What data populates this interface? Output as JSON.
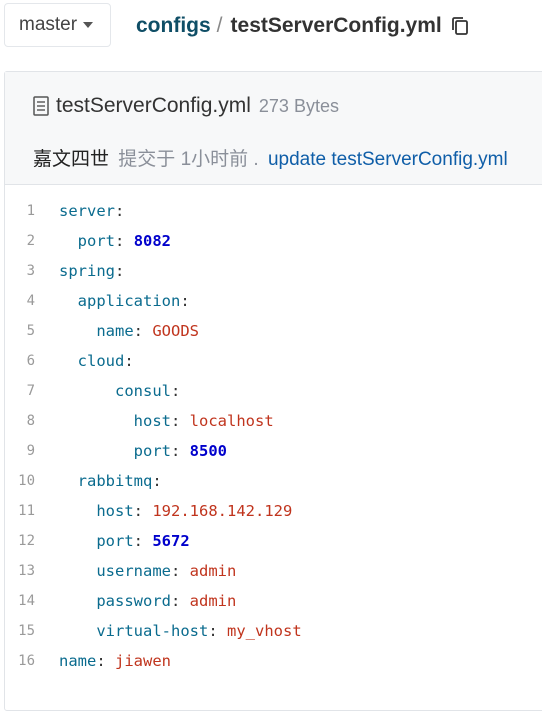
{
  "branch": {
    "label": "master"
  },
  "breadcrumb": {
    "folder": "configs",
    "separator": "/",
    "file": "testServerConfig.yml"
  },
  "file": {
    "name": "testServerConfig.yml",
    "size": "273 Bytes"
  },
  "commit": {
    "author": "嘉文四世",
    "meta": "提交于 1小时前 .",
    "message": "update testServerConfig.yml"
  },
  "code": [
    {
      "num": "1",
      "indent": "",
      "key": "server",
      "value": "",
      "type": ""
    },
    {
      "num": "2",
      "indent": "  ",
      "key": "port",
      "value": "8082",
      "type": "n"
    },
    {
      "num": "3",
      "indent": "",
      "key": "spring",
      "value": "",
      "type": ""
    },
    {
      "num": "4",
      "indent": "  ",
      "key": "application",
      "value": "",
      "type": ""
    },
    {
      "num": "5",
      "indent": "    ",
      "key": "name",
      "value": "GOODS",
      "type": "s"
    },
    {
      "num": "6",
      "indent": "  ",
      "key": "cloud",
      "value": "",
      "type": ""
    },
    {
      "num": "7",
      "indent": "      ",
      "key": "consul",
      "value": "",
      "type": ""
    },
    {
      "num": "8",
      "indent": "        ",
      "key": "host",
      "value": "localhost",
      "type": "s"
    },
    {
      "num": "9",
      "indent": "        ",
      "key": "port",
      "value": "8500",
      "type": "n"
    },
    {
      "num": "10",
      "indent": "  ",
      "key": "rabbitmq",
      "value": "",
      "type": ""
    },
    {
      "num": "11",
      "indent": "    ",
      "key": "host",
      "value": "192.168.142.129",
      "type": "s"
    },
    {
      "num": "12",
      "indent": "    ",
      "key": "port",
      "value": "5672",
      "type": "n"
    },
    {
      "num": "13",
      "indent": "    ",
      "key": "username",
      "value": "admin",
      "type": "s"
    },
    {
      "num": "14",
      "indent": "    ",
      "key": "password",
      "value": "admin",
      "type": "s"
    },
    {
      "num": "15",
      "indent": "    ",
      "key": "virtual-host",
      "value": "my_vhost",
      "type": "s"
    },
    {
      "num": "16",
      "indent": "",
      "key": "name",
      "value": "jiawen",
      "type": "s"
    }
  ]
}
